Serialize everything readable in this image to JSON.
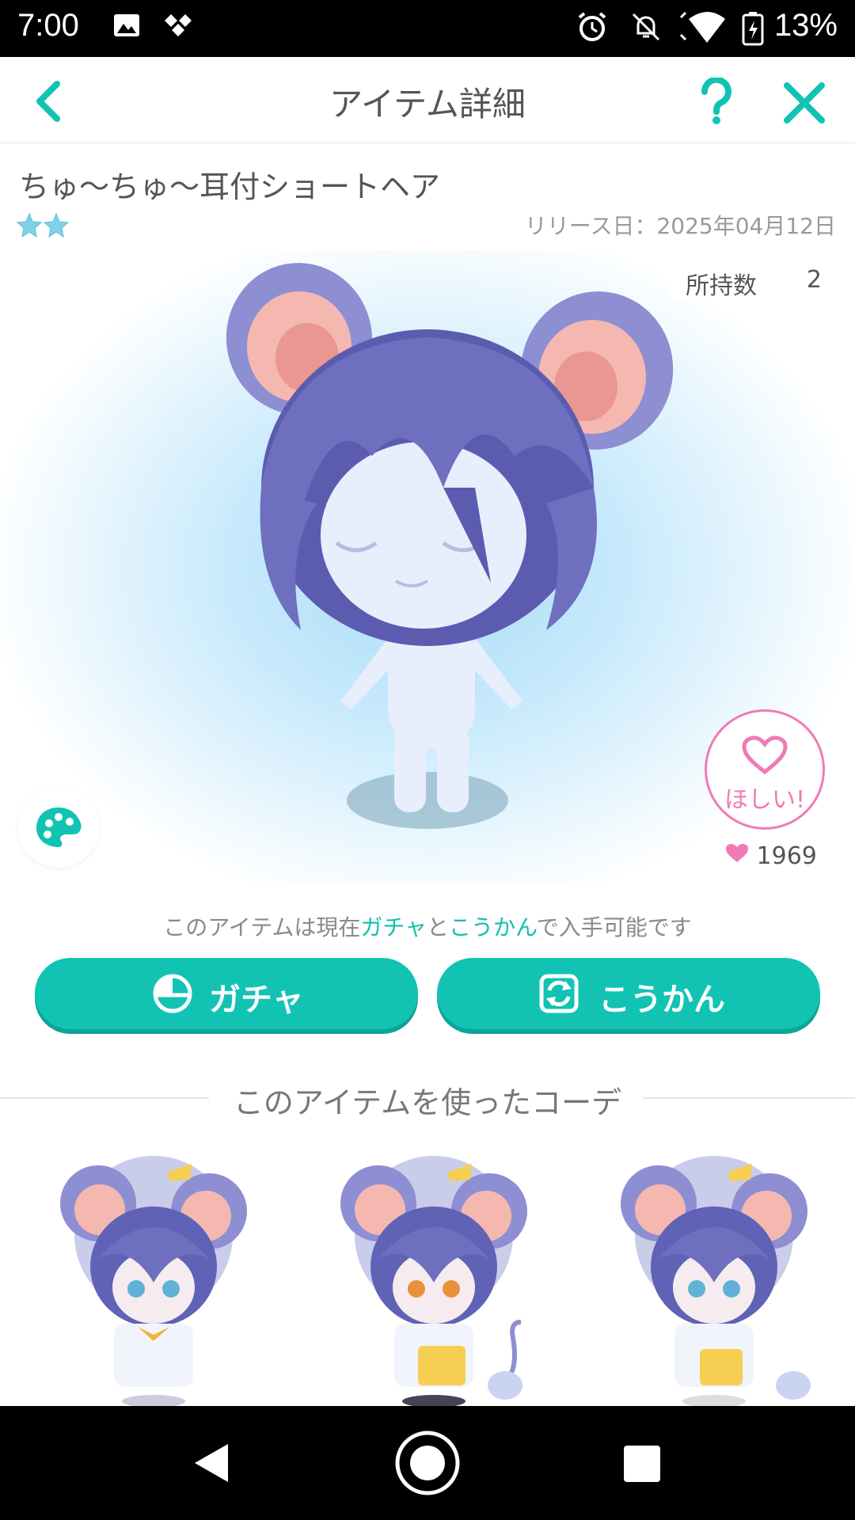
{
  "status_bar": {
    "time": "7:00",
    "battery": "13%"
  },
  "header": {
    "title": "アイテム詳細"
  },
  "item": {
    "name": "ちゅ〜ちゅ〜耳付ショートヘア",
    "stars": 2,
    "release_date": "リリース日：2025年04月12日",
    "owned_label": "所持数",
    "owned_count": "2"
  },
  "wish": {
    "label": "ほしい!",
    "count": "1969"
  },
  "availability": {
    "prefix": "このアイテムは現在",
    "gacha": "ガチャ",
    "and": "と",
    "koukan": "こうかん",
    "suffix": "で入手可能です"
  },
  "buttons": {
    "gacha": "ガチャ",
    "koukan": "こうかん"
  },
  "coordinates": {
    "title": "このアイテムを使ったコーデ"
  },
  "colors": {
    "accent": "#12c3b4",
    "wish": "#f07ab5",
    "hair": "#6f6fc0"
  }
}
